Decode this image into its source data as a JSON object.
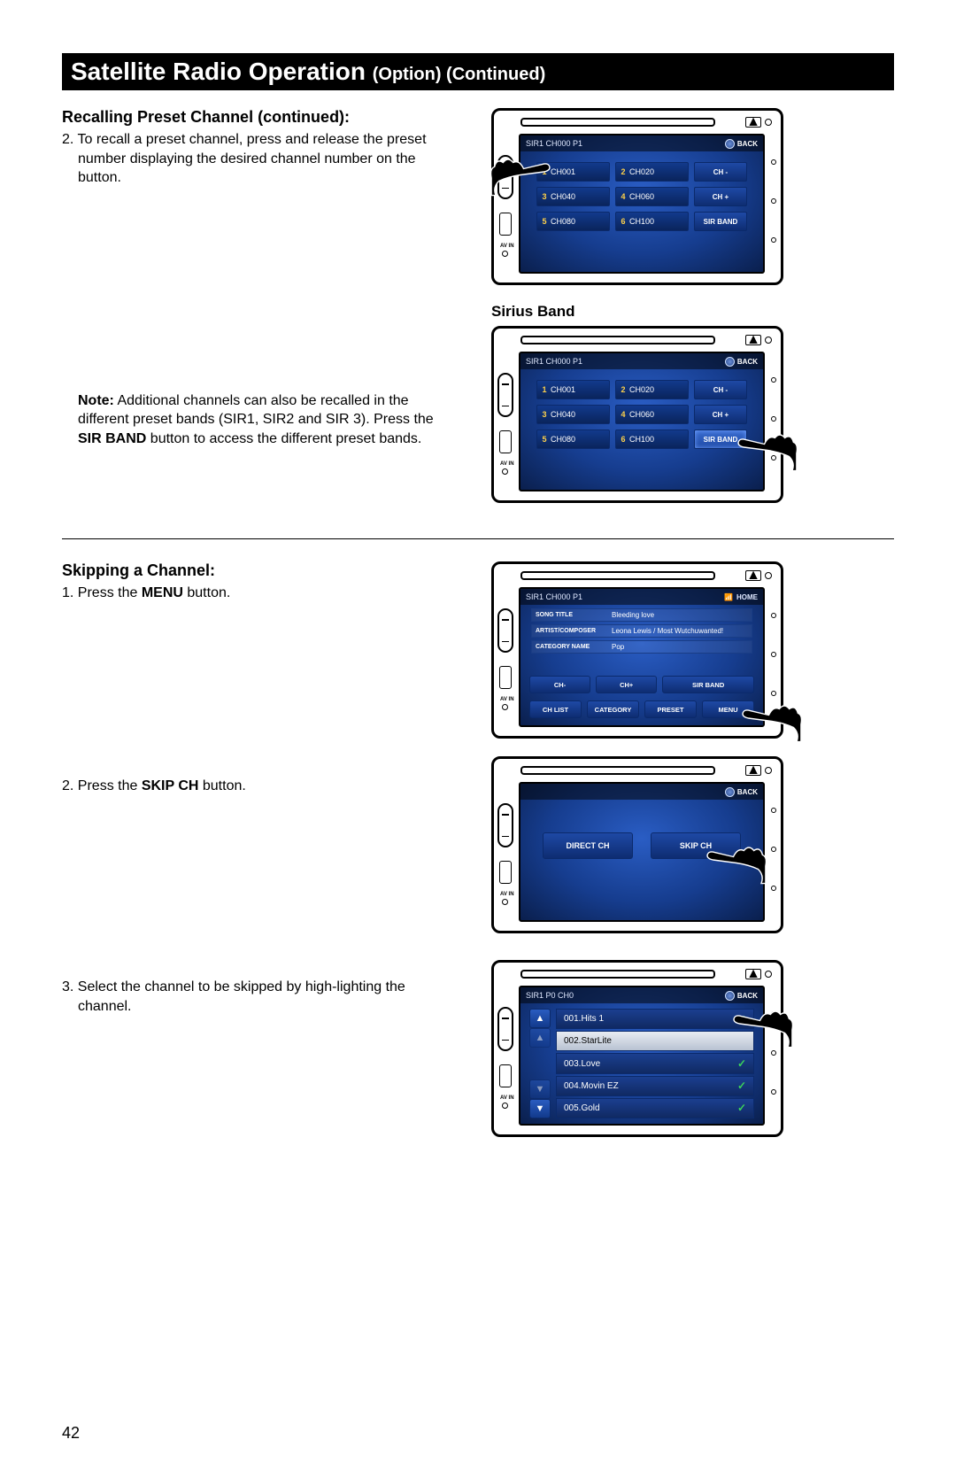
{
  "title": {
    "main": "Satellite Radio Operation ",
    "sub": "(Option) (Continued)"
  },
  "section1": {
    "heading": "Recalling Preset Channel (continued):",
    "step": "2. To recall a preset channel, press and release the preset number displaying the desired channel number on the button.",
    "note_label": "Note:",
    "note_body": " Additional channels can also be recalled in the different preset bands (SIR1, SIR2 and SIR 3). Press the ",
    "note_bold": "SIR BAND",
    "note_body2": " button to access the different preset bands."
  },
  "fig_sirius_label": "Sirius Band",
  "section2": {
    "heading": "Skipping a Channel:",
    "step1_a": "1. Press the ",
    "step1_bold": "MENU",
    "step1_b": " button.",
    "step2_a": "2. Press the ",
    "step2_bold": "SKIP CH",
    "step2_b": " button.",
    "step3": "3. Select the channel to be skipped by high-lighting the channel."
  },
  "screen_header": {
    "status": "SIR1 CH000 P1",
    "back": "BACK",
    "home": "HOME"
  },
  "presets": [
    {
      "n": "1",
      "ch": "CH001"
    },
    {
      "n": "2",
      "ch": "CH020"
    },
    {
      "n": "3",
      "ch": "CH040"
    },
    {
      "n": "4",
      "ch": "CH060"
    },
    {
      "n": "5",
      "ch": "CH080"
    },
    {
      "n": "6",
      "ch": "CH100"
    }
  ],
  "side_buttons": {
    "chminus": "CH -",
    "chplus": "CH +",
    "sirband": "SIR BAND"
  },
  "nowplaying": {
    "rows": [
      {
        "label": "SONG TITLE",
        "value": "Bleeding love"
      },
      {
        "label": "ARTIST/COMPOSER",
        "value": "Leona Lewis / Most Wutchuwanted!"
      },
      {
        "label": "CATEGORY NAME",
        "value": "Pop"
      }
    ],
    "row1": [
      "CH-",
      "CH+",
      "SIR BAND"
    ],
    "row2": [
      "CH LIST",
      "CATEGORY",
      "PRESET",
      "MENU"
    ]
  },
  "twobtn": {
    "left": "DIRECT CH",
    "right": "SKIP CH"
  },
  "list_header": "SIR1 P0 CH0",
  "channels": [
    {
      "name": "001.Hits 1",
      "sel": false
    },
    {
      "name": "002.StarLite",
      "sel": true
    },
    {
      "name": "003.Love",
      "sel": false
    },
    {
      "name": "004.Movin EZ",
      "sel": false
    },
    {
      "name": "005.Gold",
      "sel": false
    }
  ],
  "page_number": "42"
}
